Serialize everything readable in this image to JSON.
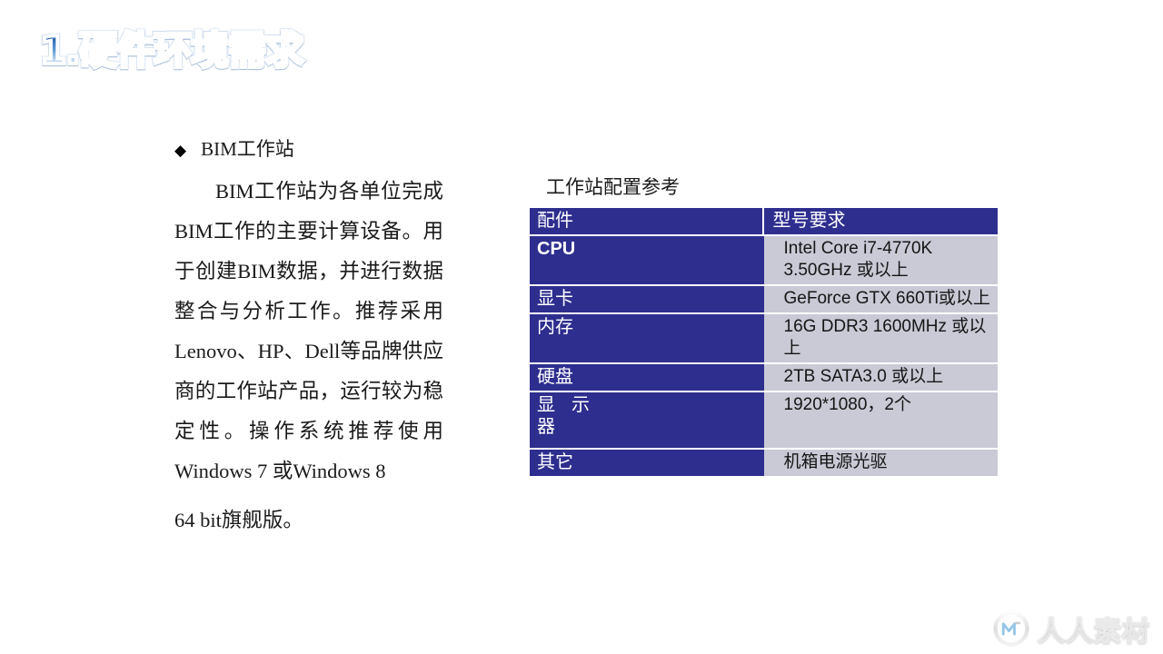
{
  "slide": {
    "title": "1.硬件环境需求",
    "background_color": "#ffffff"
  },
  "left_column": {
    "bullet_marker": "◆",
    "bullet_label": "BIM工作站",
    "paragraph": "BIM工作站为各单位完成BIM工作的主要计算设备。用于创建BIM数据，并进行数据整合与分析工作。推荐采用Lenovo、HP、Dell等品牌供应商的工作站产品，运行较为稳定性。操作系统推荐使用Windows 7 或Windows 8",
    "paragraph_tail": "64 bit旗舰版。"
  },
  "right_column": {
    "caption": "工作站配置参考",
    "table": {
      "header": [
        "配件",
        "型号要求"
      ],
      "rows": [
        {
          "key": "CPU",
          "key_latin": true,
          "value": "Intel Core i7-4770K   3.50GHz ",
          "value_cjk": "或以上"
        },
        {
          "key": "显卡",
          "key_latin": false,
          "value": "GeForce GTX 660Ti",
          "value_cjk": "或以上"
        },
        {
          "key": "内存",
          "key_latin": false,
          "value": "16G  DDR3 1600MHz ",
          "value_cjk": "或以上"
        },
        {
          "key": "硬盘",
          "key_latin": false,
          "value": "2TB  SATA3.0 ",
          "value_cjk": "或以上"
        },
        {
          "key": "显 示器",
          "key_latin": false,
          "value": "1920*1080，2",
          "value_cjk": "个"
        },
        {
          "key": "其它",
          "key_latin": false,
          "value": "",
          "value_cjk": "机箱电源光驱"
        }
      ]
    },
    "colors": {
      "header_bg": "#2e2e8f",
      "key_bg": "#2e2e8f",
      "value_bg": "#c9cad6",
      "grid": "#ffffff"
    }
  },
  "watermark": {
    "text": "人人素材",
    "logo_icon": "circle-m-logo-icon"
  }
}
